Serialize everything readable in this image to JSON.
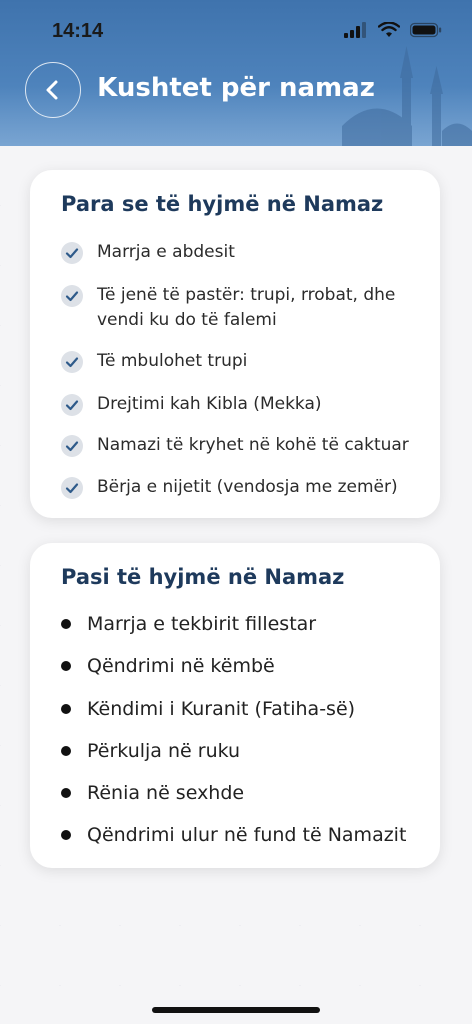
{
  "status_bar": {
    "time": "14:14",
    "icons": [
      "cellular-signal-icon",
      "wifi-icon",
      "battery-icon"
    ]
  },
  "header": {
    "title": "Kushtet për namaz",
    "back_icon": "chevron-left-icon"
  },
  "before_section": {
    "title": "Para se të hyjmë në Namaz",
    "items": [
      "Marrja e abdesit",
      "Të jenë të pastër: trupi, rrobat, dhe vendi ku do të falemi",
      "Të mbulohet trupi",
      "Drejtimi kah Kibla (Mekka)",
      "Namazi të kryhet në kohë të caktuar",
      "Bërja e nijetit (vendosja me zemër)"
    ]
  },
  "after_section": {
    "title": "Pasi të hyjmë në Namaz",
    "items": [
      "Marrja e tekbirit fillestar",
      "Qëndrimi në  këmbë",
      "Këndimi i Kuranit (Fatiha-së)",
      "Përkulja në ruku",
      "Rënia në sexhde",
      "Qëndrimi ulur në fund të Namazit"
    ]
  },
  "colors": {
    "header_blue": "#4a7fb8",
    "title_navy": "#1e3a5c",
    "check_bg": "#dde1e7",
    "check_mark": "#2e5a8a"
  }
}
